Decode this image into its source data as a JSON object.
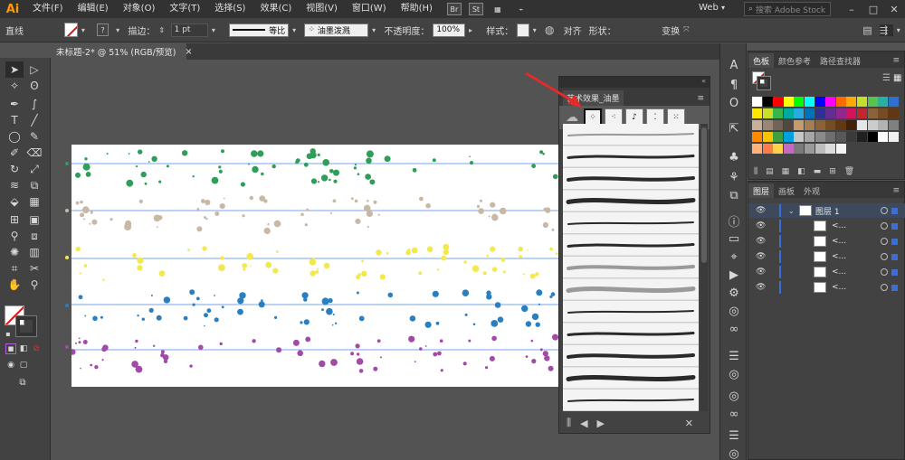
{
  "app": {
    "logo": "Ai"
  },
  "menu": [
    "文件(F)",
    "编辑(E)",
    "对象(O)",
    "文字(T)",
    "选择(S)",
    "效果(C)",
    "视图(V)",
    "窗口(W)",
    "帮助(H)"
  ],
  "menubar_icons": {
    "bridge": "Br",
    "stock": "St"
  },
  "workspace": "Web",
  "search_placeholder": "搜索 Adobe Stock",
  "control": {
    "object_type": "直线",
    "stroke_label": "描边：",
    "stroke_value": "1 pt",
    "profile": "等比",
    "brush": "油墨泼溅",
    "opacity_label": "不透明度：",
    "opacity_value": "100%",
    "style_label": "样式：",
    "align": "对齐",
    "shape": "形状：",
    "transform": "变换"
  },
  "document_tab": {
    "title": "未标题-2* @ 51% (RGB/预览)",
    "close": "×"
  },
  "brush_panel": {
    "title": "艺术效果_油墨"
  },
  "swatches_panel": {
    "tabs": [
      "色板",
      "颜色参考",
      "路径查找器"
    ]
  },
  "layers_panel": {
    "tabs": [
      "图层",
      "画板",
      "外观"
    ],
    "layer_name": "图层 1",
    "sublayer_label": "<..."
  },
  "colors": {
    "accent": "#ff9a00",
    "selection": "#3a6fd8",
    "artboard": "#ffffff"
  },
  "splatter_colors": [
    "#2e9e58",
    "#c8b8a6",
    "#f2e94e",
    "#2a7fc0",
    "#a24aa8"
  ]
}
